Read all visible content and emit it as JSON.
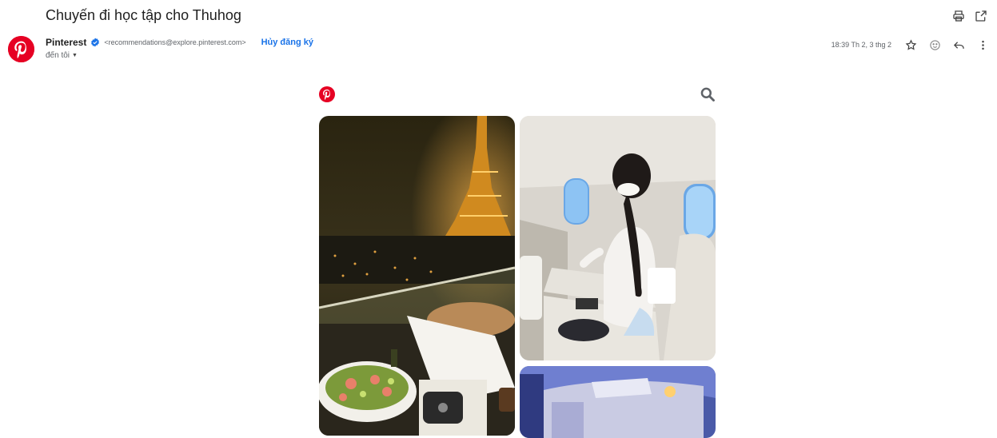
{
  "email": {
    "subject": "Chuyến đi học tập cho Thuhog",
    "sender_name": "Pinterest",
    "sender_email": "<recommendations@explore.pinterest.com>",
    "unsubscribe_label": "Hủy đăng ký",
    "to_label": "đến tôi",
    "timestamp": "18:39 Th 2, 3 thg 2"
  },
  "icons": {
    "print": "print-icon",
    "open_new_window": "open-in-new-window-icon",
    "star": "star-icon",
    "emoji": "emoji-icon",
    "reply": "reply-icon",
    "more": "more-vert-icon",
    "verified": "verified-badge-icon",
    "brand": "pinterest-logo-icon",
    "search": "search-icon"
  },
  "colors": {
    "pinterest_red": "#e60023",
    "link_blue": "#1a73e8",
    "verified_blue": "#1a73e8"
  },
  "body": {
    "pins": [
      {
        "name": "paris-eiffel-dinner-pin"
      },
      {
        "name": "airplane-window-girl-pin"
      },
      {
        "name": "airplane-cabin-pin"
      }
    ]
  }
}
